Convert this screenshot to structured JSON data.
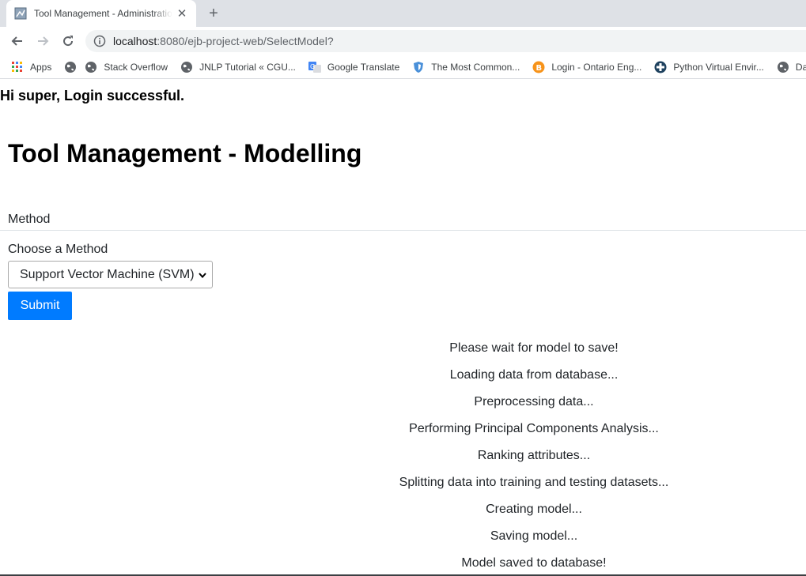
{
  "browser": {
    "tab_title": "Tool Management - Administration",
    "new_tab_symbol": "+",
    "close_symbol": "✕",
    "url_host": "localhost",
    "url_rest": ":8080/ejb-project-web/SelectModel?",
    "bookmarks": [
      {
        "label": "Apps",
        "icon": "apps-grid-icon"
      },
      {
        "label": "",
        "icon": "globe-icon"
      },
      {
        "label": "Stack Overflow",
        "icon": "globe-icon"
      },
      {
        "label": "JNLP Tutorial « CGU...",
        "icon": "globe-icon"
      },
      {
        "label": "Google Translate",
        "icon": "google-translate-icon"
      },
      {
        "label": "The Most Common...",
        "icon": "shield-icon"
      },
      {
        "label": "Login - Ontario Eng...",
        "icon": "bitcoin-icon"
      },
      {
        "label": "Python Virtual Envir...",
        "icon": "python-icon"
      },
      {
        "label": "Day",
        "icon": "globe-icon"
      }
    ]
  },
  "page": {
    "welcome": "Hi super, Login successful.",
    "title": "Tool Management - Modelling",
    "section_label": "Method",
    "field_label": "Choose a Method",
    "selected_method": "Support Vector Machine (SVM)",
    "submit_label": "Submit",
    "status_lines": [
      "Please wait for model to save!",
      "Loading data from database...",
      "Preprocessing data...",
      "Performing Principal Components Analysis...",
      "Ranking attributes...",
      "Splitting data into training and testing datasets...",
      "Creating model...",
      "Saving model...",
      "Model saved to database!"
    ]
  },
  "colors": {
    "primary_button": "#007bff",
    "tabstrip": "#dee1e6"
  }
}
